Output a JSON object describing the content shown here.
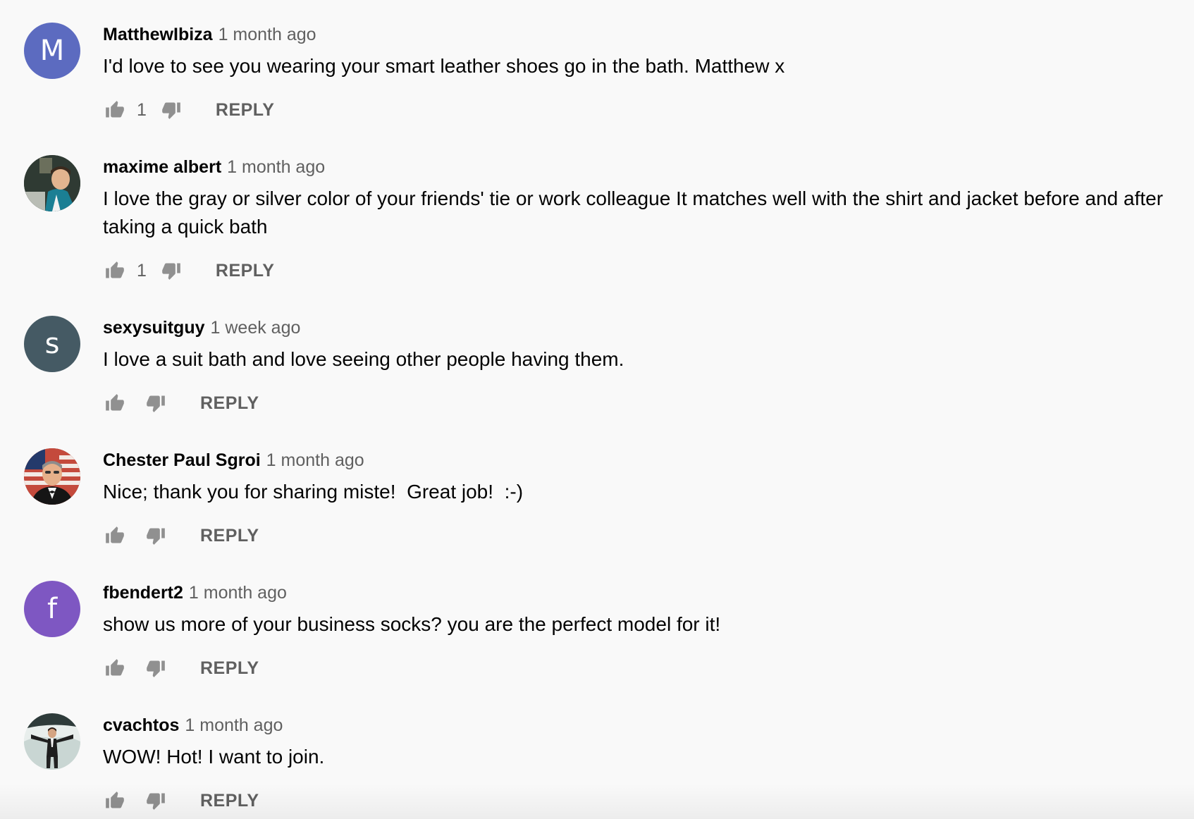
{
  "reply_label": "REPLY",
  "comments": [
    {
      "author": "MatthewIbiza",
      "time": "1 month ago",
      "text": "I'd love to see you wearing your smart leather shoes go in the bath. Matthew x",
      "likes": "1",
      "avatar": {
        "type": "letter",
        "letter": "M",
        "color": "#5c6bc0"
      }
    },
    {
      "author": "maxime albert",
      "time": "1 month ago",
      "text": "I love the gray or silver color of your friends' tie or work colleague It matches well with the shirt and jacket before and after taking a quick bath",
      "likes": "1",
      "avatar": {
        "type": "photo",
        "icon": "person-photo-icon"
      }
    },
    {
      "author": "sexysuitguy",
      "time": "1 week ago",
      "text": "I love a suit bath and love seeing other people having them.",
      "likes": "",
      "avatar": {
        "type": "letter",
        "letter": "s",
        "color": "#455a64"
      }
    },
    {
      "author": "Chester Paul Sgroi",
      "time": "1 month ago",
      "text": "Nice; thank you for sharing miste!  Great job!  :-)",
      "likes": "",
      "avatar": {
        "type": "photo",
        "icon": "person-flag-photo-icon"
      }
    },
    {
      "author": "fbendert2",
      "time": "1 month ago",
      "text": "show us more of your business socks? you are the perfect model for it!",
      "likes": "",
      "avatar": {
        "type": "letter",
        "letter": "f",
        "color": "#7e57c2"
      }
    },
    {
      "author": "cvachtos",
      "time": "1 month ago",
      "text": "WOW! Hot! I want to join.",
      "likes": "",
      "avatar": {
        "type": "photo",
        "icon": "person-snow-photo-icon"
      }
    }
  ]
}
